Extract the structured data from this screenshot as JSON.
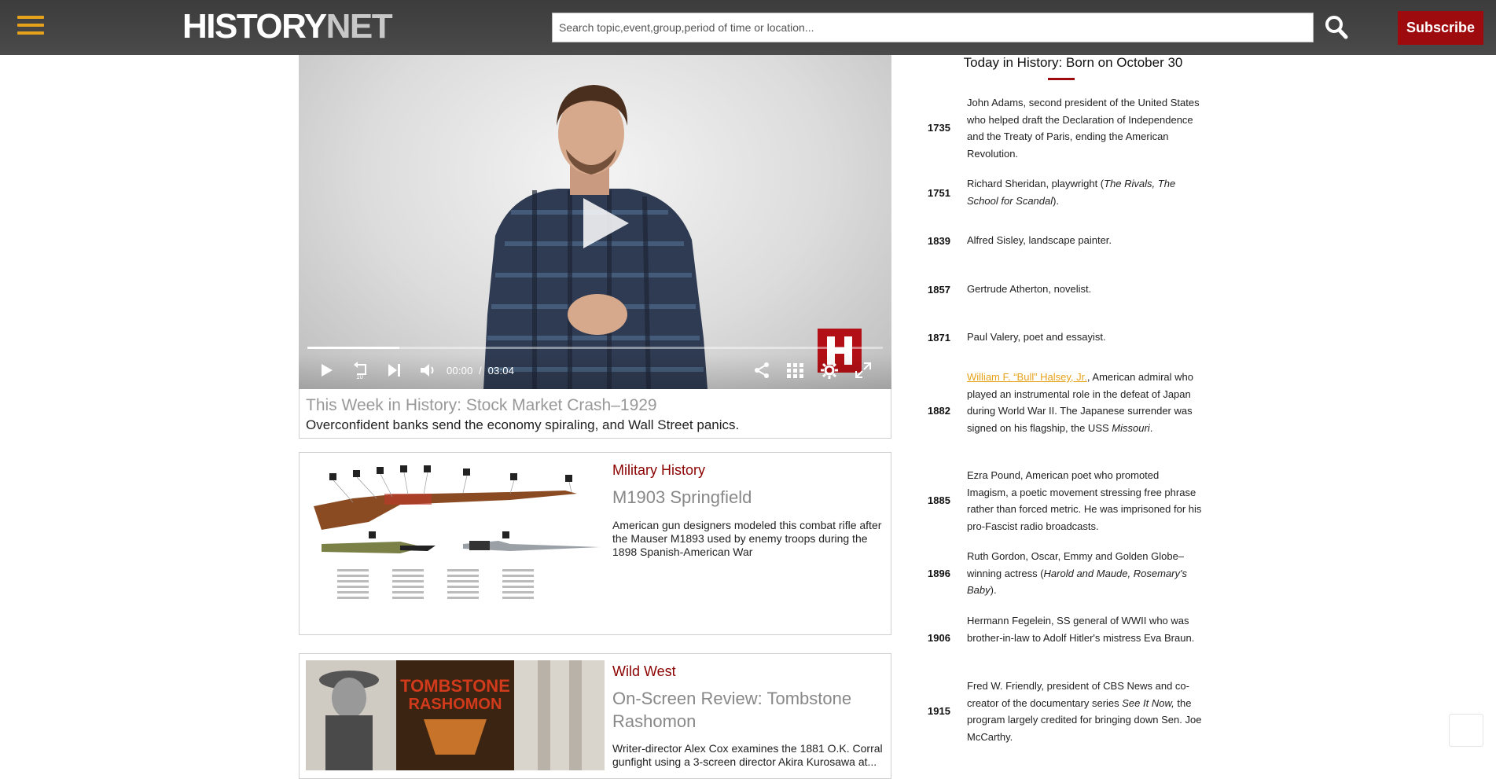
{
  "header": {
    "logo_primary": "HISTORY",
    "logo_secondary": "NET",
    "search_placeholder": "Search topic,event,group,period of time or location...",
    "subscribe_label": "Subscribe"
  },
  "colors": {
    "brand_red": "#9e0b0f",
    "menu_gold": "#e6a21b",
    "header_bg": "#424242"
  },
  "video": {
    "current_time": "00:00",
    "separator": "/",
    "duration": "03:04",
    "progress_fraction": 0.16,
    "title": "This Week in History: Stock Market Crash–1929",
    "description": "Overconfident banks send the economy spiraling, and Wall Street panics."
  },
  "cards": [
    {
      "category": "Military History",
      "title": "M1903 Springfield",
      "description": "American gun designers modeled this combat rifle after the Mauser M1893 used by enemy troops during the 1898 Spanish-American War"
    },
    {
      "category": "Wild West",
      "title": "On-Screen Review: Tombstone Rashomon",
      "description": "Writer-director Alex Cox examines the 1881 O.K. Corral gunfight using a 3-screen director Akira Kurosawa at..."
    }
  ],
  "sidebar": {
    "title": "Today in History: Born on October 30",
    "births": [
      {
        "year": "1735",
        "text": "John Adams, second president of the United States who helped draft the Declaration of Independence and the Treaty of Paris, ending the American Revolution."
      },
      {
        "year": "1751",
        "pre": "Richard Sheridan, playwright (",
        "italic": "The Rivals, The School for Scandal",
        "post": ")."
      },
      {
        "year": "1839",
        "text": "Alfred Sisley, landscape painter."
      },
      {
        "year": "1857",
        "text": "Gertrude Atherton, novelist."
      },
      {
        "year": "1871",
        "text": "Paul Valery, poet and essayist."
      },
      {
        "year": "1882",
        "link": "William F. “Bull” Halsey, Jr.",
        "pre": ", American admiral who played an instrumental role in the defeat of Japan during World War II. The Japanese surrender was signed on his flagship, the USS ",
        "italic": "Missouri",
        "post": "."
      },
      {
        "year": "1885",
        "text": "Ezra Pound, American poet who promoted Imagism, a poetic movement stressing free phrase rather than forced metric. He was imprisoned for his pro-Fascist radio broadcasts."
      },
      {
        "year": "1896",
        "pre": "Ruth Gordon, Oscar, Emmy and Golden Globe–winning actress (",
        "italic": "Harold and Maude, Rosemary's Baby",
        "post": ")."
      },
      {
        "year": "1906",
        "text": "Hermann Fegelein, SS general of WWII who was brother-in-law to Adolf Hitler's mistress Eva Braun."
      },
      {
        "year": "1915",
        "pre": "Fred W. Friendly, president of CBS News and co-creator of the documentary series ",
        "italic": "See It Now,",
        "post": " the program largely credited for bringing down Sen. Joe McCarthy."
      }
    ]
  }
}
